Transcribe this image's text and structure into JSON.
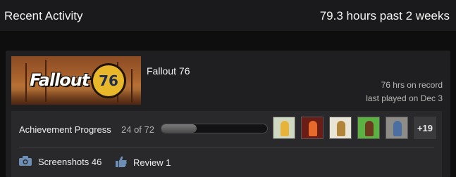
{
  "header": {
    "title": "Recent Activity",
    "hours_summary": "79.3 hours past 2 weeks"
  },
  "game": {
    "name": "Fallout 76",
    "logo_word": "Fallout",
    "logo_number": "76",
    "hours_on_record": "76 hrs on record",
    "last_played": "last played on Dec 3"
  },
  "achievements": {
    "label": "Achievement Progress",
    "count": "24 of 72",
    "progress_fraction": 0.333,
    "icons": [
      {
        "name": "vault-boy-achievement-icon",
        "bg": "#cfd8c0",
        "fig": "#e7b33a"
      },
      {
        "name": "fire-achievement-icon",
        "bg": "#6a1d16",
        "fig": "#e86a2a"
      },
      {
        "name": "vault-boy-hat-achievement-icon",
        "bg": "#e8e4d6",
        "fig": "#b2843a"
      },
      {
        "name": "green-achievement-icon",
        "bg": "#5bb243",
        "fig": "#6a3b1e"
      },
      {
        "name": "vault-boy-gray-achievement-icon",
        "bg": "#8e8c86",
        "fig": "#4b6fa0"
      }
    ],
    "more_label": "+19"
  },
  "footer": {
    "screenshots_label": "Screenshots 46",
    "review_label": "Review 1"
  },
  "colors": {
    "background": "#0e0e0f",
    "header": "#1a1a1c",
    "card": "#1f1f21",
    "panel": "#29292c"
  }
}
